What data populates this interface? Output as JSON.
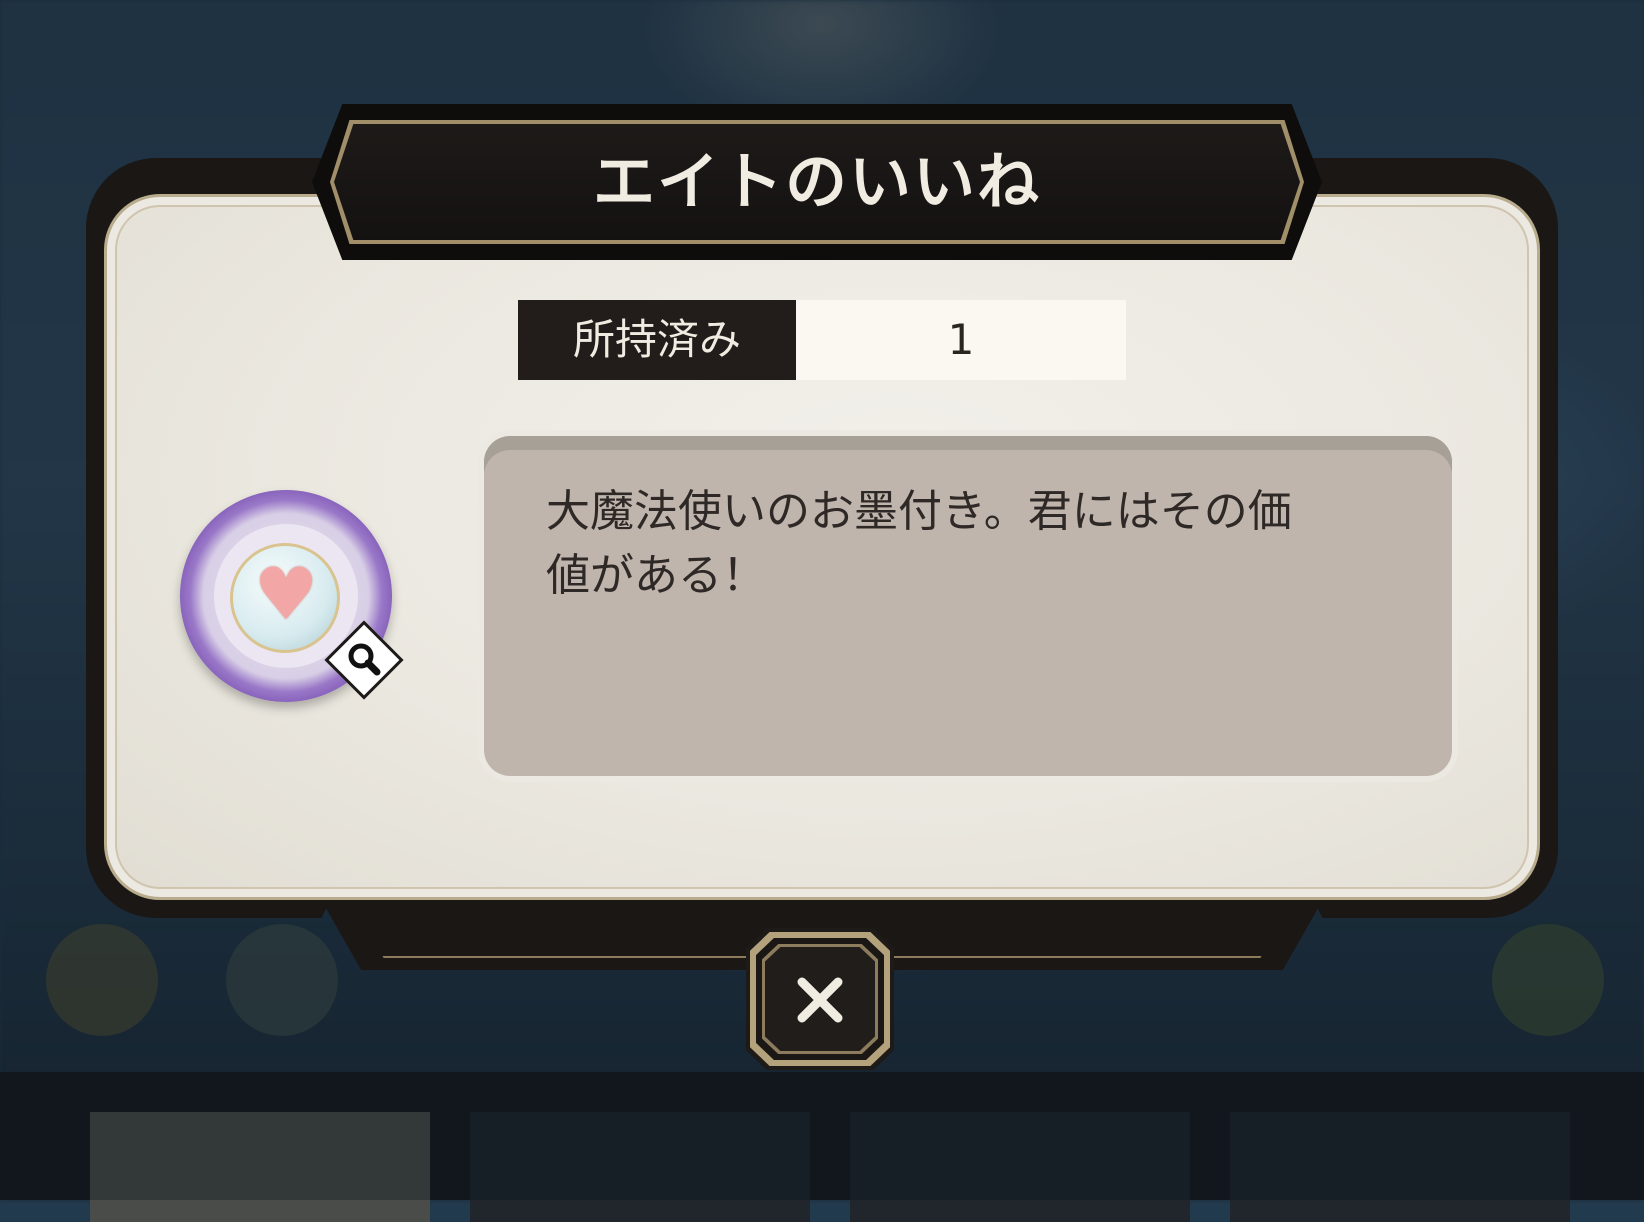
{
  "dialog": {
    "title": "エイトのいいね",
    "owned_label": "所持済み",
    "owned_count": "1",
    "description": "大魔法使いのお墨付き。君にはその価\n値がある！",
    "item_icon": "heart-sticker-icon",
    "magnifier_icon": "magnifier-icon",
    "close_icon": "close-icon"
  },
  "colors": {
    "panel": "#ebe8e0",
    "header": "#141211",
    "accent_gold": "#a18f6a",
    "description_bg": "#c0b5ad",
    "item_ring": "#7d58b4"
  }
}
